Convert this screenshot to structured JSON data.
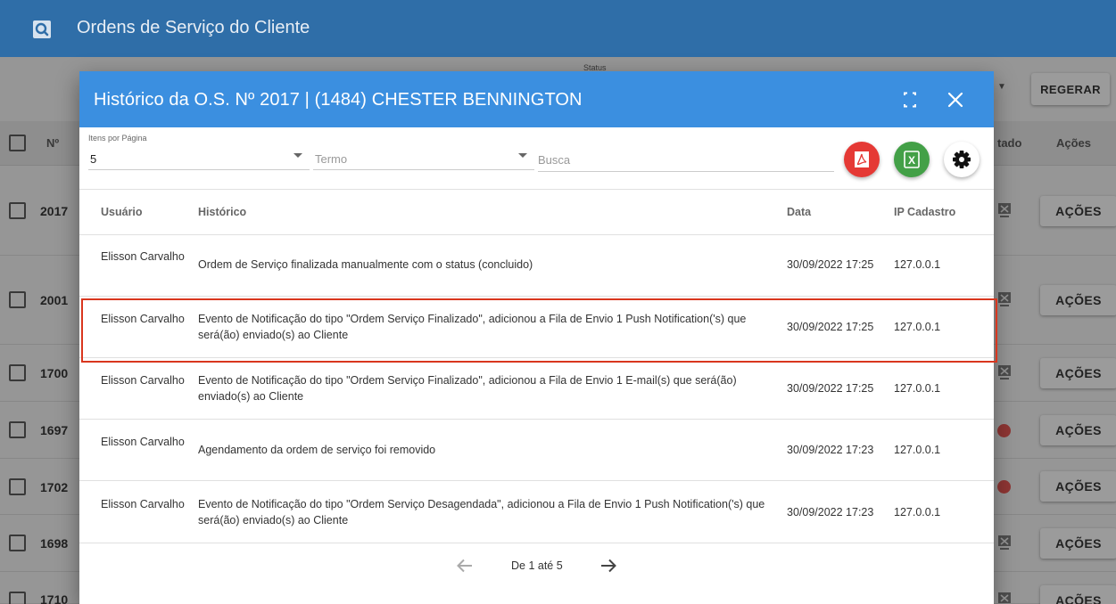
{
  "app": {
    "title": "Ordens de Serviço do Cliente",
    "logo_icon": "search-icon"
  },
  "background_page": {
    "status_label": "Status",
    "regerar_label": "REGERAR",
    "columns": {
      "number": "Nº",
      "status": "tado",
      "actions": "Ações"
    },
    "rows": [
      {
        "id": "2017",
        "action_label": "AÇÕES",
        "status_icon": "printer-icon"
      },
      {
        "id": "2001",
        "action_label": "AÇÕES",
        "status_icon": "printer-icon"
      },
      {
        "id": "1700",
        "action_label": "AÇÕES",
        "status_icon": "printer-icon"
      },
      {
        "id": "1697",
        "action_label": "AÇÕES",
        "status_icon": "cancel-icon"
      },
      {
        "id": "1702",
        "action_label": "AÇÕES",
        "status_icon": "cancel-icon"
      },
      {
        "id": "1698",
        "action_label": "AÇÕES",
        "status_icon": "printer-icon"
      },
      {
        "id": "1710",
        "action_label": "AÇÕES",
        "status_icon": "printer-icon"
      }
    ]
  },
  "dialog": {
    "title": "Histórico da O.S. Nº 2017 | (1484) CHESTER BENNINGTON",
    "toolbar": {
      "per_page_label": "Itens por Página",
      "per_page_value": "5",
      "term_placeholder": "Termo",
      "search_placeholder": "Busca",
      "pdf_icon": "pdf-icon",
      "excel_icon": "excel-icon",
      "excel_glyph": "X",
      "settings_icon": "gear-icon"
    },
    "table": {
      "headers": {
        "user": "Usuário",
        "history": "Histórico",
        "date": "Data",
        "ip": "IP Cadastro"
      },
      "rows": [
        {
          "user": "Elisson Carvalho",
          "history": "Ordem de Serviço finalizada manualmente com o status (concluido)",
          "date": "30/09/2022 17:25",
          "ip": "127.0.0.1"
        },
        {
          "user": "Elisson Carvalho",
          "history": "Evento de Notificação do tipo \"Ordem Serviço Finalizado\", adicionou a Fila de Envio 1 Push Notification('s) que será(ão) enviado(s) ao Cliente",
          "date": "30/09/2022 17:25",
          "ip": "127.0.0.1",
          "highlighted": true
        },
        {
          "user": "Elisson Carvalho",
          "history": "Evento de Notificação do tipo \"Ordem Serviço Finalizado\", adicionou a Fila de Envio 1 E-mail(s) que será(ão) enviado(s) ao Cliente",
          "date": "30/09/2022 17:25",
          "ip": "127.0.0.1"
        },
        {
          "user": "Elisson Carvalho",
          "history": "Agendamento da ordem de serviço foi removido",
          "date": "30/09/2022 17:23",
          "ip": "127.0.0.1"
        },
        {
          "user": "Elisson Carvalho",
          "history": "Evento de Notificação do tipo \"Ordem Serviço Desagendada\", adicionou a Fila de Envio 1 Push Notification('s) que será(ão) enviado(s) ao Cliente",
          "date": "30/09/2022 17:23",
          "ip": "127.0.0.1"
        }
      ]
    },
    "pagination": {
      "info": "De 1 até 5",
      "prev_icon": "arrow-left-icon",
      "next_icon": "arrow-right-icon"
    }
  }
}
